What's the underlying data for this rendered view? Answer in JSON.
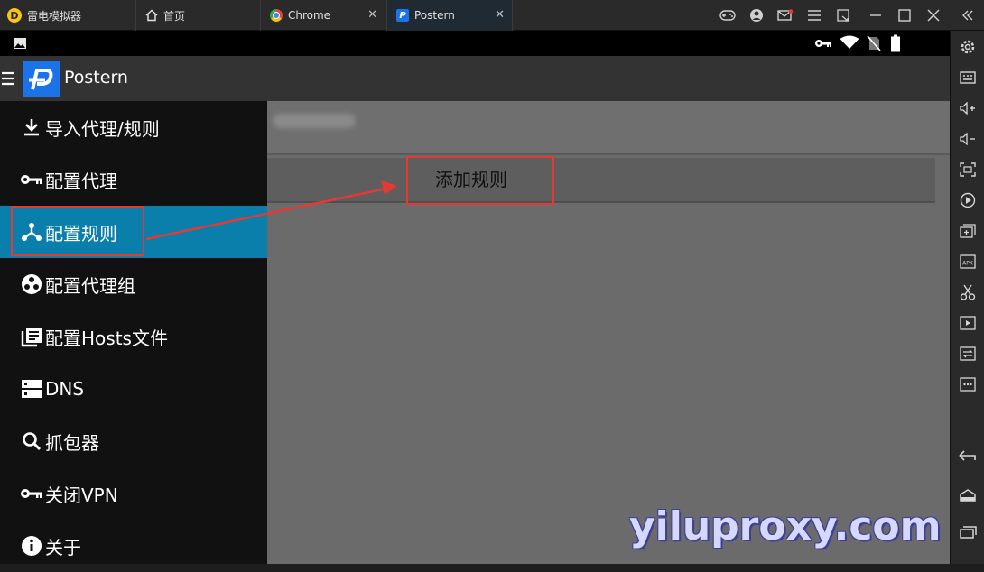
{
  "emulator": {
    "app_name": "雷电模拟器",
    "tabs": [
      {
        "label": "首页"
      },
      {
        "label": "Chrome"
      },
      {
        "label": "Postern"
      }
    ]
  },
  "app": {
    "title": "Postern"
  },
  "drawer": {
    "items": [
      {
        "label": "导入代理/规则",
        "icon": "download-icon"
      },
      {
        "label": "配置代理",
        "icon": "key-icon"
      },
      {
        "label": "配置规则",
        "icon": "rule-tree-icon",
        "active": true
      },
      {
        "label": "配置代理组",
        "icon": "proxy-group-icon"
      },
      {
        "label": "配置Hosts文件",
        "icon": "hosts-file-icon"
      },
      {
        "label": "DNS",
        "icon": "dns-server-icon"
      },
      {
        "label": "抓包器",
        "icon": "search-icon"
      },
      {
        "label": "关闭VPN",
        "icon": "key-icon"
      },
      {
        "label": "关于",
        "icon": "info-icon"
      }
    ]
  },
  "content": {
    "add_rule_label": "添加规则"
  },
  "watermark": "yiluproxy.com",
  "colors": {
    "active_item": "#0b7fab",
    "annotation": "#e53935",
    "app_icon": "#1a73e8"
  }
}
